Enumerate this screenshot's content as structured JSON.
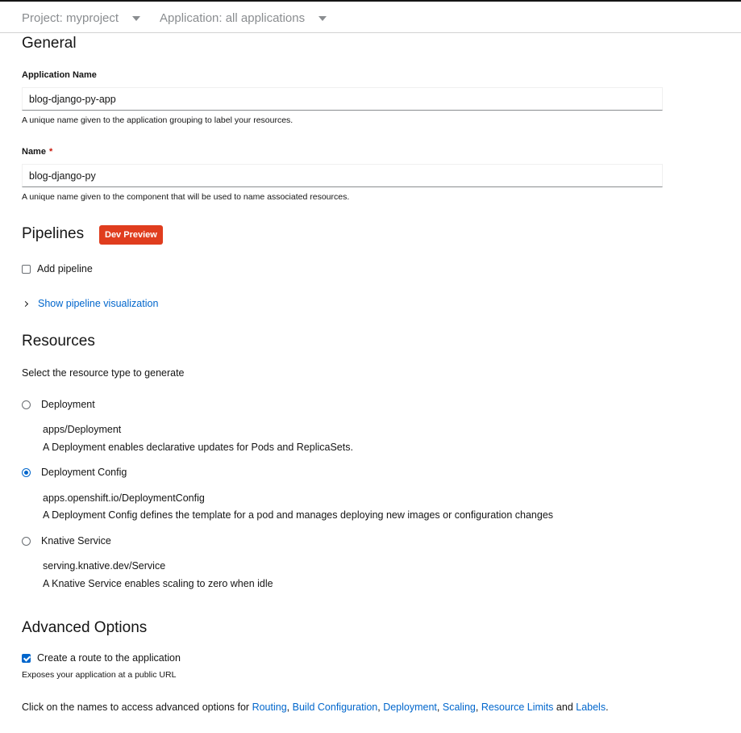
{
  "topbar": {
    "project_label": "Project: myproject",
    "application_label": "Application: all applications"
  },
  "general": {
    "heading": "General",
    "app_name_label": "Application Name",
    "app_name_value": "blog-django-py-app",
    "app_name_help": "A unique name given to the application grouping to label your resources.",
    "name_label": "Name",
    "name_required": "*",
    "name_value": "blog-django-py",
    "name_help": "A unique name given to the component that will be used to name associated resources."
  },
  "pipelines": {
    "heading": "Pipelines",
    "badge": "Dev Preview",
    "add_pipeline_label": "Add pipeline",
    "add_pipeline_checked": false,
    "show_visualization_label": "Show pipeline visualization"
  },
  "resources": {
    "heading": "Resources",
    "description": "Select the resource type to generate",
    "options": [
      {
        "label": "Deployment",
        "api": "apps/Deployment",
        "description": "A Deployment enables declarative updates for Pods and ReplicaSets.",
        "selected": false
      },
      {
        "label": "Deployment Config",
        "api": "apps.openshift.io/DeploymentConfig",
        "description": "A Deployment Config defines the template for a pod and manages deploying new images or configuration changes",
        "selected": true
      },
      {
        "label": "Knative Service",
        "api": "serving.knative.dev/Service",
        "description": "A Knative Service enables scaling to zero when idle",
        "selected": false
      }
    ]
  },
  "advanced": {
    "heading": "Advanced Options",
    "route_label": "Create a route to the application",
    "route_checked": true,
    "route_help": "Exposes your application at a public URL",
    "links_prefix": "Click on the names to access advanced options for ",
    "links": {
      "routing": "Routing",
      "build": "Build Configuration",
      "deployment": "Deployment",
      "scaling": "Scaling",
      "resource_limits": "Resource Limits",
      "labels": "Labels"
    },
    "sep_comma": ", ",
    "sep_and": " and ",
    "links_suffix": "."
  },
  "colors": {
    "link": "#0066cc",
    "badge": "#e03d1e",
    "required": "#c9190b",
    "muted": "#8a8d90"
  }
}
